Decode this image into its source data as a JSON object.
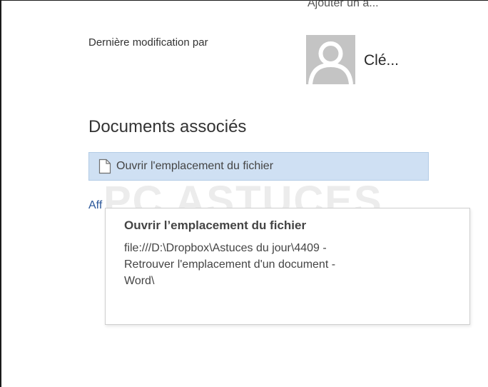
{
  "properties": {
    "add_author_label": "Ajouter un a...",
    "last_modified_by_label": "Dernière modification par",
    "author_name": "Clé..."
  },
  "related_documents": {
    "title": "Documents associés",
    "open_location_label": "Ouvrir l'emplacement du fichier",
    "show_all_link_label": "Aff"
  },
  "watermark": {
    "text": "PC ASTUCES"
  },
  "tooltip": {
    "title": "Ouvrir l’emplacement du fichier",
    "path_line1": "file:///D:\\Dropbox\\Astuces du jour\\4409 -",
    "path_line2": "Retrouver l'emplacement d'un document -",
    "path_line3": "Word\\"
  },
  "colors": {
    "selection_background": "#cfe0f3",
    "link": "#2b579a",
    "avatar_background": "#c4c4c4"
  },
  "icons": {
    "avatar": "person-silhouette-icon",
    "open_location": "document-icon"
  }
}
